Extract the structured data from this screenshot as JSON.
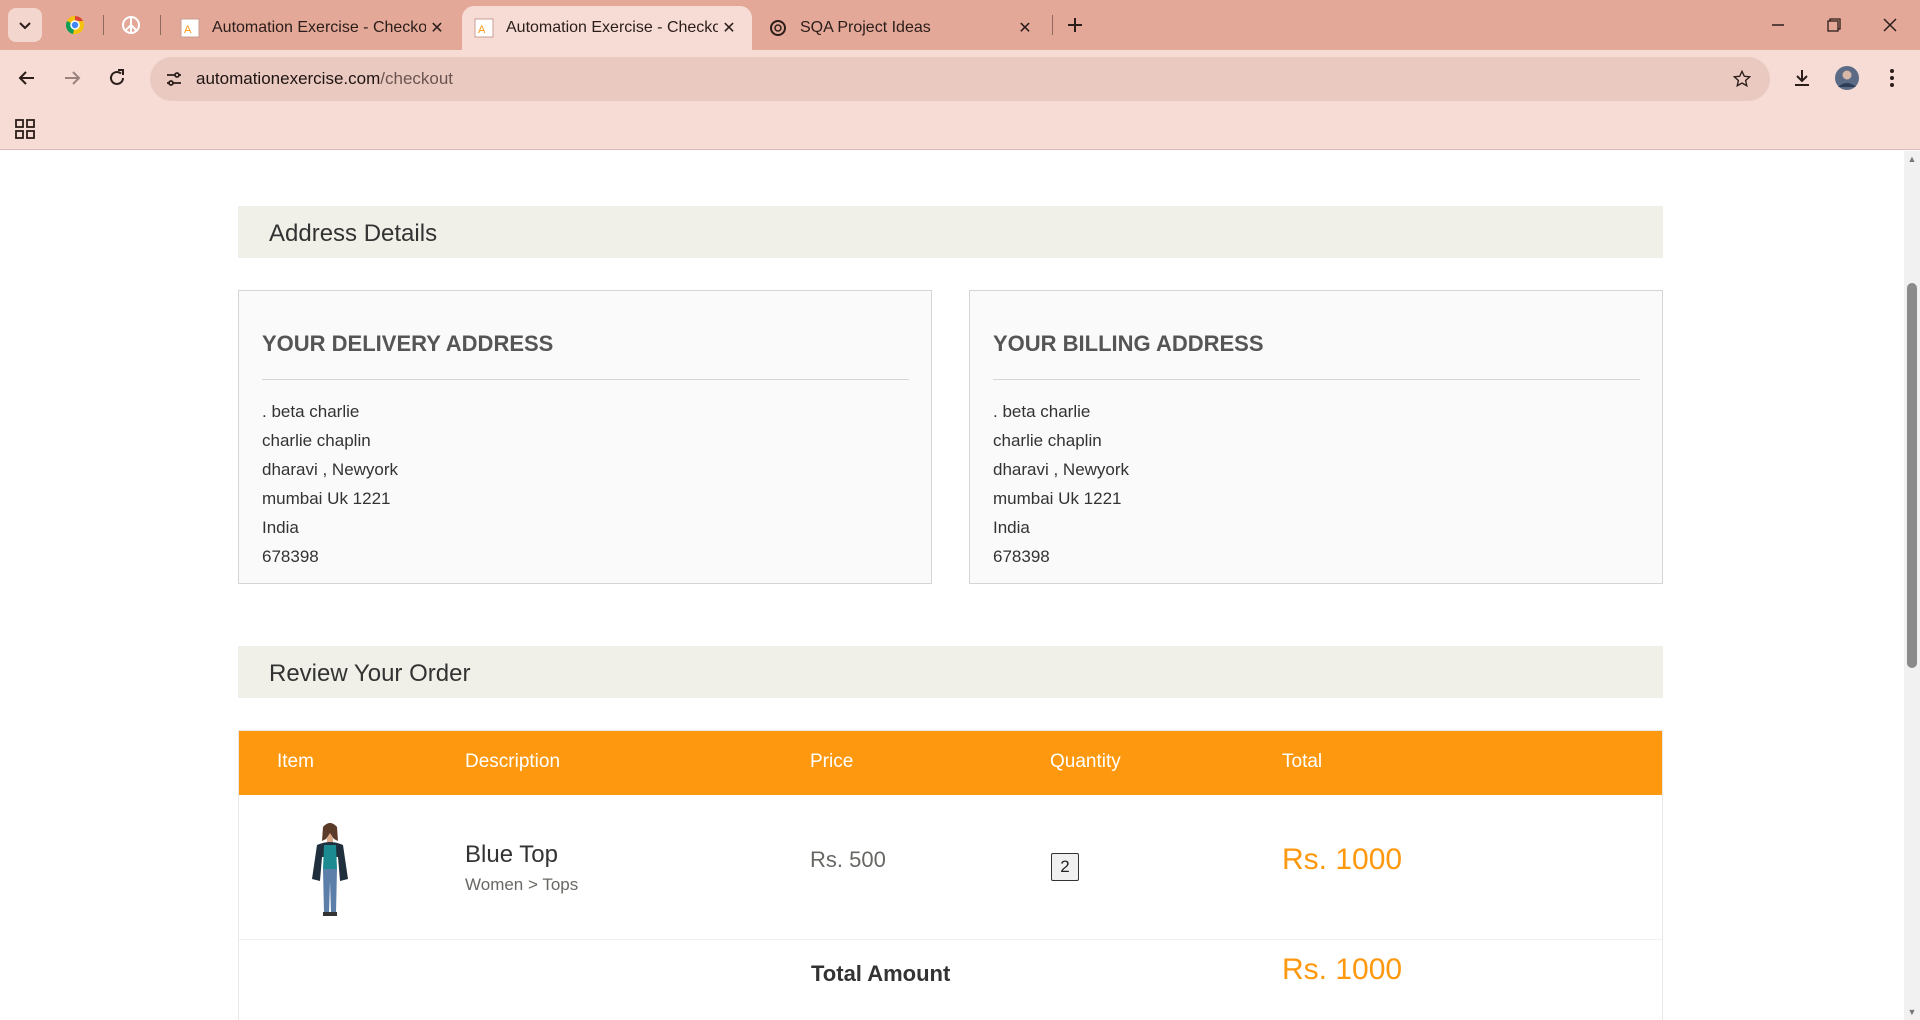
{
  "browser": {
    "tabs": [
      {
        "title": "Automation Exercise - Checkout",
        "active": false
      },
      {
        "title": "Automation Exercise - Checkout",
        "active": true
      },
      {
        "title": "SQA Project Ideas",
        "active": false
      }
    ],
    "address": {
      "host": "automationexercise.com",
      "path": "/checkout"
    },
    "colors": {
      "tabstrip": "#e3a898",
      "toolbar": "#f6dcd5"
    }
  },
  "page": {
    "address_section": "Address Details",
    "delivery": {
      "title": "YOUR DELIVERY ADDRESS",
      "lines": [
        ". beta charlie",
        "charlie chaplin",
        "dharavi , Newyork",
        "mumbai Uk 1221",
        "India",
        "678398"
      ]
    },
    "billing": {
      "title": "YOUR BILLING ADDRESS",
      "lines": [
        ". beta charlie",
        "charlie chaplin",
        "dharavi , Newyork",
        "mumbai Uk 1221",
        "India",
        "678398"
      ]
    },
    "review_section": "Review Your Order",
    "cart": {
      "headers": {
        "item": "Item",
        "description": "Description",
        "price": "Price",
        "quantity": "Quantity",
        "total": "Total"
      },
      "items": [
        {
          "name": "Blue Top",
          "category": "Women > Tops",
          "price": "Rs. 500",
          "quantity": "2",
          "total": "Rs. 1000"
        }
      ],
      "total_label": "Total Amount",
      "total_value": "Rs. 1000"
    },
    "colors": {
      "accent": "#fe980f",
      "section_bg": "#f0f0e9"
    }
  }
}
